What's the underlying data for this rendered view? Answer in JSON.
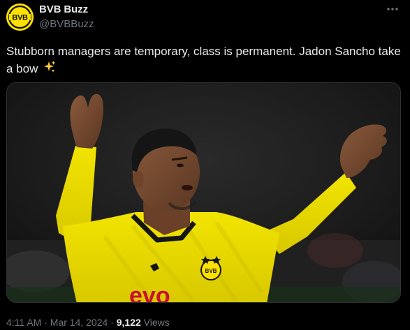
{
  "author": {
    "display_name": "BVB Buzz",
    "handle": "@BVBBuzz",
    "avatar_letters": "BVB"
  },
  "tweet": {
    "text": "Stubborn managers are temporary, class is permanent. Jadon Sancho take a bow",
    "emoji": "sparkles"
  },
  "media": {
    "jersey_sponsor_text": "evo",
    "crest_letters": "BVB"
  },
  "meta": {
    "time": "4:11 AM",
    "separator": "·",
    "date": "Mar 14, 2024",
    "views_count": "9,122",
    "views_label": "Views"
  },
  "colors": {
    "background": "#000000",
    "text_primary": "#e7e9ea",
    "text_secondary": "#71767b",
    "border": "#2f3336",
    "bvb_yellow": "#fde100"
  },
  "icons": {
    "more": "more-horizontal-icon",
    "emoji": "sparkles-icon"
  }
}
